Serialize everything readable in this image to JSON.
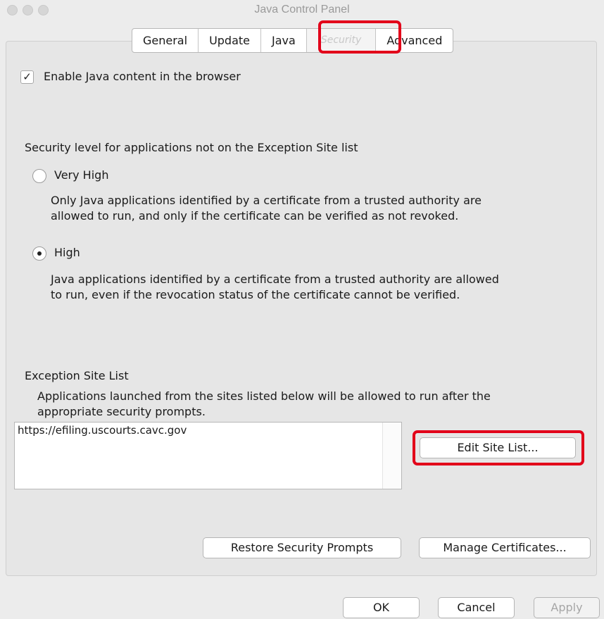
{
  "window": {
    "title": "Java Control Panel"
  },
  "tabs": [
    {
      "label": "General"
    },
    {
      "label": "Update"
    },
    {
      "label": "Java"
    },
    {
      "label": "Security",
      "selected": true
    },
    {
      "label": "Advanced"
    }
  ],
  "browser": {
    "checkbox_label": "Enable Java content in the browser",
    "checked": true
  },
  "security_level": {
    "heading": "Security level for applications not on the Exception Site list",
    "options": [
      {
        "label": "Very High",
        "selected": false,
        "desc_line1": "Only Java applications identified by a certificate from a trusted authority are",
        "desc_line2": "allowed to run, and only if the certificate can be verified as not revoked."
      },
      {
        "label": "High",
        "selected": true,
        "desc_line1": "Java applications identified by a certificate from a trusted authority are allowed",
        "desc_line2": "to run, even if the revocation status of the certificate cannot be verified."
      }
    ]
  },
  "exception": {
    "heading": "Exception Site List",
    "desc_line1": "Applications launched from the sites listed below will be allowed to run after the",
    "desc_line2": "appropriate security prompts.",
    "sites": [
      "https://efiling.uscourts.cavc.gov"
    ],
    "edit_button": "Edit Site List..."
  },
  "buttons": {
    "restore": "Restore Security Prompts",
    "manage": "Manage Certificates...",
    "ok": "OK",
    "cancel": "Cancel",
    "apply": "Apply"
  },
  "colors": {
    "highlight": "#e2001a",
    "panel": "#e6e6e6",
    "window": "#ececec"
  }
}
